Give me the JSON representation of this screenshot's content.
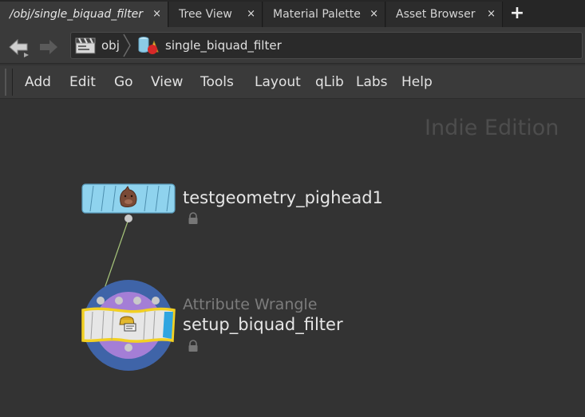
{
  "tabs": [
    {
      "label": "/obj/single_biquad_filter",
      "close": "×",
      "active": true
    },
    {
      "label": "Tree View",
      "close": "×",
      "active": false
    },
    {
      "label": "Material Palette",
      "close": "×",
      "active": false
    },
    {
      "label": "Asset Browser",
      "close": "×",
      "active": false
    }
  ],
  "tab_add": "+",
  "path": {
    "root": "obj",
    "current": "single_biquad_filter"
  },
  "menu": [
    "Add",
    "Edit",
    "Go",
    "View",
    "Tools",
    "Layout",
    "qLib",
    "Labs",
    "Help"
  ],
  "watermark": "Indie Edition",
  "nodes": {
    "geo": {
      "name": "testgeometry_pighead1",
      "icon": "pighead-icon",
      "color": "#8fd3ee"
    },
    "wrangle": {
      "type": "Attribute Wrangle",
      "name": "setup_biquad_filter",
      "icon": "wrangle-icon",
      "color": "#e6e6e6"
    }
  },
  "colors": {
    "background": "#333333",
    "selection_outline": "#f2d023",
    "wrangle_ring_outer": "#3f64a8",
    "wrangle_ring_inner": "#a47ed6",
    "wire": "#a6c47a"
  }
}
